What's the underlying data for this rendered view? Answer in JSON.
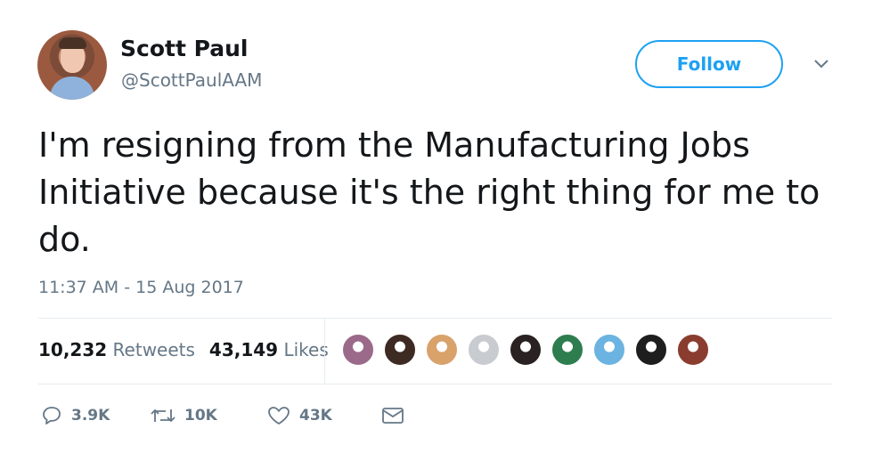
{
  "user": {
    "name": "Scott Paul",
    "handle": "@ScottPaulAAM"
  },
  "follow_label": "Follow",
  "tweet_text": "I'm resigning from the Manufacturing Jobs Initiative because it's the right thing for me to do.",
  "timestamp": "11:37 AM - 15 Aug 2017",
  "stats": {
    "retweets_count": "10,232",
    "retweets_label": "Retweets",
    "likes_count": "43,149",
    "likes_label": "Likes"
  },
  "likers": [
    {
      "icon": "liker-avatar-1",
      "color": "#9b6a8a"
    },
    {
      "icon": "liker-avatar-2",
      "color": "#3d2a22"
    },
    {
      "icon": "liker-avatar-3",
      "color": "#d9a26b"
    },
    {
      "icon": "liker-avatar-4",
      "color": "#c8ccd0"
    },
    {
      "icon": "liker-avatar-5",
      "color": "#2a2222"
    },
    {
      "icon": "liker-avatar-6",
      "color": "#2e7d4f"
    },
    {
      "icon": "liker-avatar-7",
      "color": "#6bb3e0"
    },
    {
      "icon": "liker-avatar-8",
      "color": "#1e1e1e"
    },
    {
      "icon": "liker-avatar-9",
      "color": "#8a3d2e"
    }
  ],
  "actions": {
    "reply_count": "3.9K",
    "retweet_count": "10K",
    "like_count": "43K"
  },
  "colors": {
    "accent": "#1da1f2",
    "secondary_text": "#657786",
    "primary_text": "#14171a",
    "divider": "#e6ecf0"
  }
}
